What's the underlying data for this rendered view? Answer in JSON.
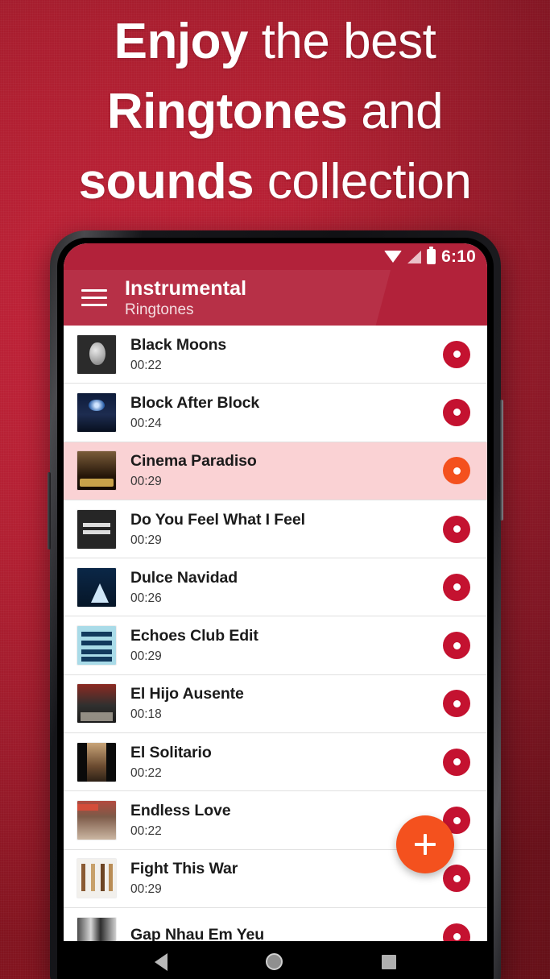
{
  "promo": {
    "lines": [
      {
        "bold": "Enjoy",
        "light": " the best"
      },
      {
        "bold": "Ringtones",
        "light": " and"
      },
      {
        "bold": "sounds",
        "light": " collection"
      }
    ]
  },
  "colors": {
    "background_red": "#b51f2e",
    "appbar_red": "#b2223a",
    "accent_orange": "#f4511e",
    "play_button_red": "#c41230",
    "selected_row_pink": "#fad2d4"
  },
  "statusbar": {
    "time": "6:10",
    "icons": [
      "wifi-icon",
      "signal-icon",
      "battery-icon"
    ]
  },
  "appbar": {
    "menu_icon": "hamburger-menu-icon",
    "title": "Instrumental",
    "subtitle": "Ringtones"
  },
  "list": {
    "items": [
      {
        "title": "Black Moons",
        "duration": "00:22",
        "art": "art-moon",
        "selected": false
      },
      {
        "title": "Block After Block",
        "duration": "00:24",
        "art": "art-block1",
        "selected": false
      },
      {
        "title": "Cinema Paradiso",
        "duration": "00:29",
        "art": "art-cinema",
        "selected": true
      },
      {
        "title": "Do You Feel What I Feel",
        "duration": "00:29",
        "art": "art-doyou",
        "selected": false
      },
      {
        "title": "Dulce Navidad",
        "duration": "00:26",
        "art": "art-dulce",
        "selected": false
      },
      {
        "title": "Echoes Club Edit",
        "duration": "00:29",
        "art": "art-echoes",
        "selected": false
      },
      {
        "title": "El Hijo Ausente",
        "duration": "00:18",
        "art": "art-hijo",
        "selected": false
      },
      {
        "title": "El Solitario",
        "duration": "00:22",
        "art": "art-solitario",
        "selected": false
      },
      {
        "title": "Endless Love",
        "duration": "00:22",
        "art": "art-endless",
        "selected": false
      },
      {
        "title": "Fight This War",
        "duration": "00:29",
        "art": "art-fight",
        "selected": false
      },
      {
        "title": "Gap Nhau Em Yeu",
        "duration": "",
        "art": "art-gap",
        "selected": false
      }
    ]
  },
  "fab": {
    "icon": "plus-icon",
    "label": "+"
  },
  "navbar": {
    "back": "back-triangle-icon",
    "home": "home-circle-icon",
    "recents": "recents-square-icon"
  }
}
